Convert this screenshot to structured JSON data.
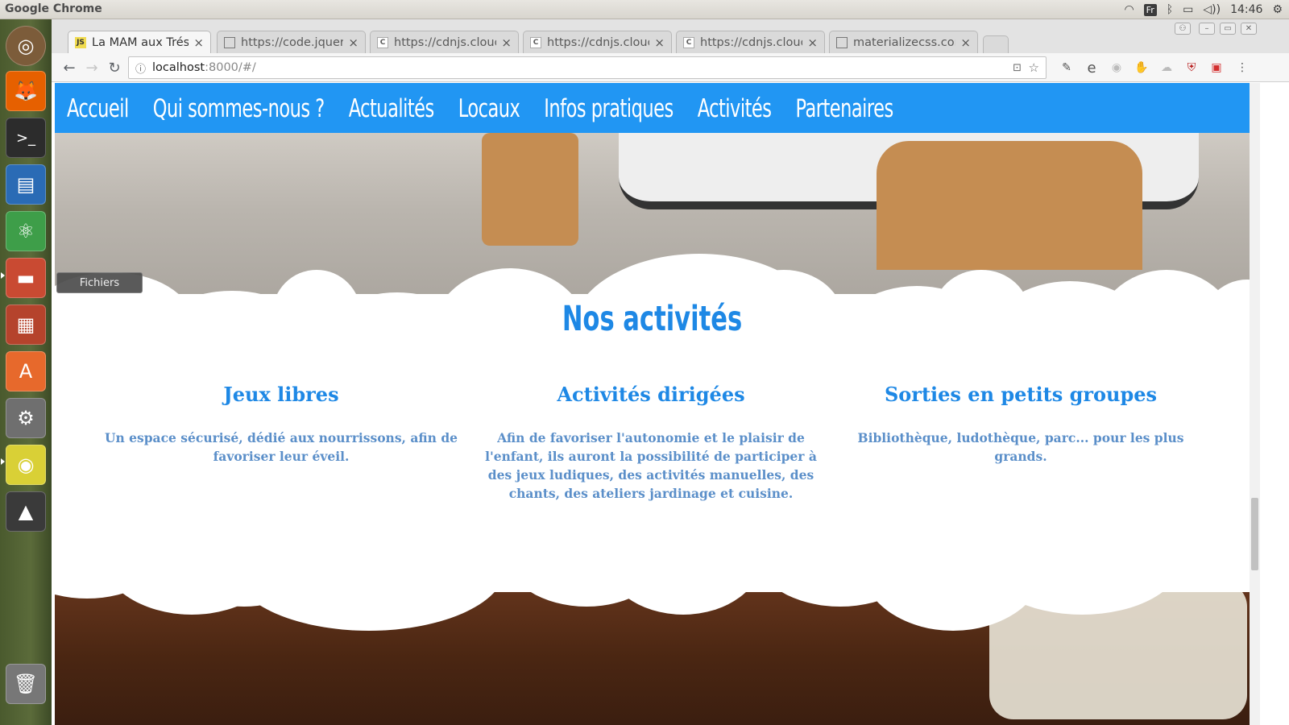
{
  "system": {
    "app_name": "Google Chrome",
    "keyboard_layout": "Fr",
    "clock": "14:46",
    "tray_icons": [
      "wifi-icon",
      "keyboard-icon",
      "bluetooth-icon",
      "battery-icon",
      "volume-icon",
      "clock",
      "settings-icon"
    ]
  },
  "launcher": {
    "tooltip": "Fichiers",
    "items": [
      "ubuntu-icon",
      "firefox-icon",
      "terminal-icon",
      "writer-icon",
      "atom-icon",
      "files-icon",
      "impress-icon",
      "software-center-icon",
      "system-settings-icon",
      "chrome-icon",
      "inkscape-icon",
      "trash-icon"
    ]
  },
  "browser": {
    "tabs": [
      {
        "title": "La MAM aux Trésor",
        "favicon": "JS",
        "active": true
      },
      {
        "title": "https://code.jquery",
        "favicon": "",
        "active": false
      },
      {
        "title": "https://cdnjs.cloud",
        "favicon": "C",
        "active": false
      },
      {
        "title": "https://cdnjs.cloud",
        "favicon": "C",
        "active": false
      },
      {
        "title": "https://cdnjs.cloud",
        "favicon": "C",
        "active": false
      },
      {
        "title": "materializecss.com",
        "favicon": "",
        "active": false
      }
    ],
    "url_host": "localhost",
    "url_path": ":8000/#/",
    "close_glyph": "×"
  },
  "site": {
    "nav": [
      "Accueil",
      "Qui sommes-nous ?",
      "Actualités",
      "Locaux",
      "Infos pratiques",
      "Activités",
      "Partenaires"
    ],
    "nav_color": "#2196f3",
    "section_title": "Nos activités",
    "accent_color": "#1e88e5",
    "activities": [
      {
        "title": "Jeux libres",
        "text": "Un espace sécurisé, dédié aux nourrissons, afin de favoriser leur éveil."
      },
      {
        "title": "Activités dirigées",
        "text": "Afin de favoriser l'autonomie et le plaisir de l'enfant, ils auront la possibilité de participer à des jeux ludiques, des activités manuelles, des chants, des ateliers jardinage et cuisine."
      },
      {
        "title": "Sorties en petits groupes",
        "text": "Bibliothèque, ludothèque, parc... pour les plus grands."
      }
    ]
  }
}
